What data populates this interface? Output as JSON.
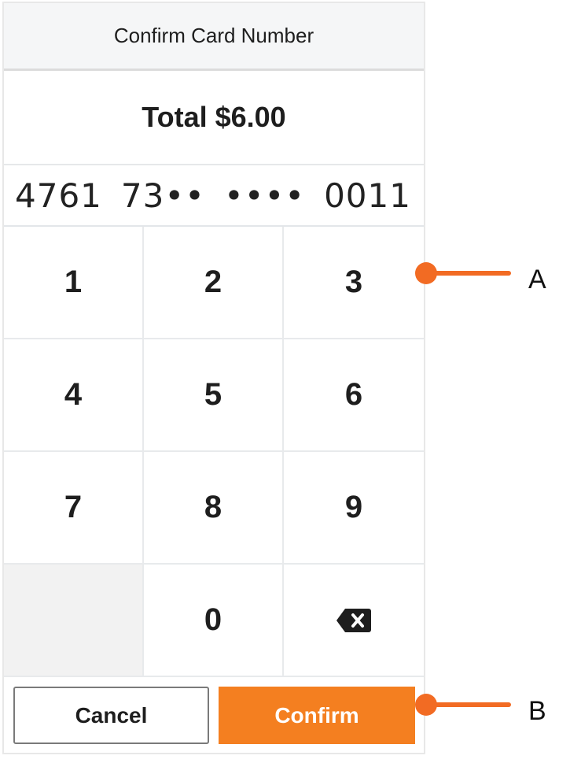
{
  "header": {
    "title": "Confirm Card Number"
  },
  "total": {
    "label": "Total $6.00"
  },
  "card_number": {
    "groups": [
      "4761",
      "73••",
      "••••",
      "0011"
    ]
  },
  "keypad": {
    "keys": [
      "1",
      "2",
      "3",
      "4",
      "5",
      "6",
      "7",
      "8",
      "9",
      "",
      "0",
      "backspace-icon"
    ]
  },
  "actions": {
    "cancel_label": "Cancel",
    "confirm_label": "Confirm"
  },
  "callouts": {
    "a": "A",
    "b": "B"
  },
  "colors": {
    "accent": "#f47f20",
    "callout": "#f26b23"
  }
}
